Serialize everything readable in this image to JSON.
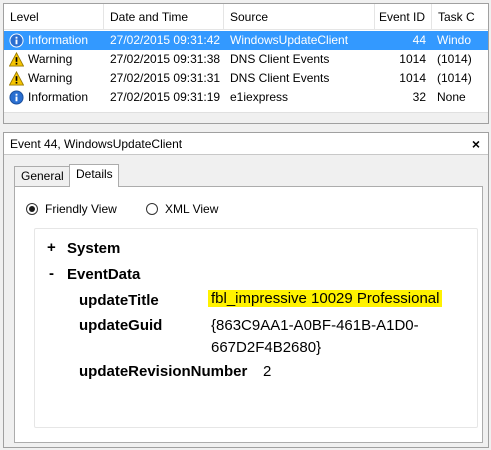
{
  "grid": {
    "columns": [
      "Level",
      "Date and Time",
      "Source",
      "Event ID",
      "Task C"
    ],
    "rows": [
      {
        "level": "Information",
        "datetime": "27/02/2015 09:31:42",
        "source": "WindowsUpdateClient",
        "event_id": "44",
        "task": "Windo",
        "icon": "info-icon",
        "selected": true
      },
      {
        "level": "Warning",
        "datetime": "27/02/2015 09:31:38",
        "source": "DNS Client Events",
        "event_id": "1014",
        "task": "(1014)",
        "icon": "warning-icon",
        "selected": false
      },
      {
        "level": "Warning",
        "datetime": "27/02/2015 09:31:31",
        "source": "DNS Client Events",
        "event_id": "1014",
        "task": "(1014)",
        "icon": "warning-icon",
        "selected": false
      },
      {
        "level": "Information",
        "datetime": "27/02/2015 09:31:19",
        "source": "e1iexpress",
        "event_id": "32",
        "task": "None",
        "icon": "info-icon",
        "selected": false
      }
    ]
  },
  "detail": {
    "title": "Event 44, WindowsUpdateClient",
    "close": "×",
    "tabs": [
      "General",
      "Details"
    ],
    "radio": {
      "friendly": "Friendly View",
      "xml": "XML View"
    },
    "tree": {
      "system_toggle": "+",
      "system_label": "System",
      "eventdata_toggle": "-",
      "eventdata_label": "EventData",
      "fields": [
        {
          "name": "updateTitle",
          "value": "fbl_impressive 10029 Professional"
        },
        {
          "name": "updateGuid",
          "value_line1": "{863C9AA1-A0BF-461B-A1D0-",
          "value_line2": "667D2F4B2680}"
        },
        {
          "name": "updateRevisionNumber",
          "value": "2"
        }
      ]
    }
  },
  "colors": {
    "selection": "#3399ff",
    "highlight": "#fff200"
  }
}
